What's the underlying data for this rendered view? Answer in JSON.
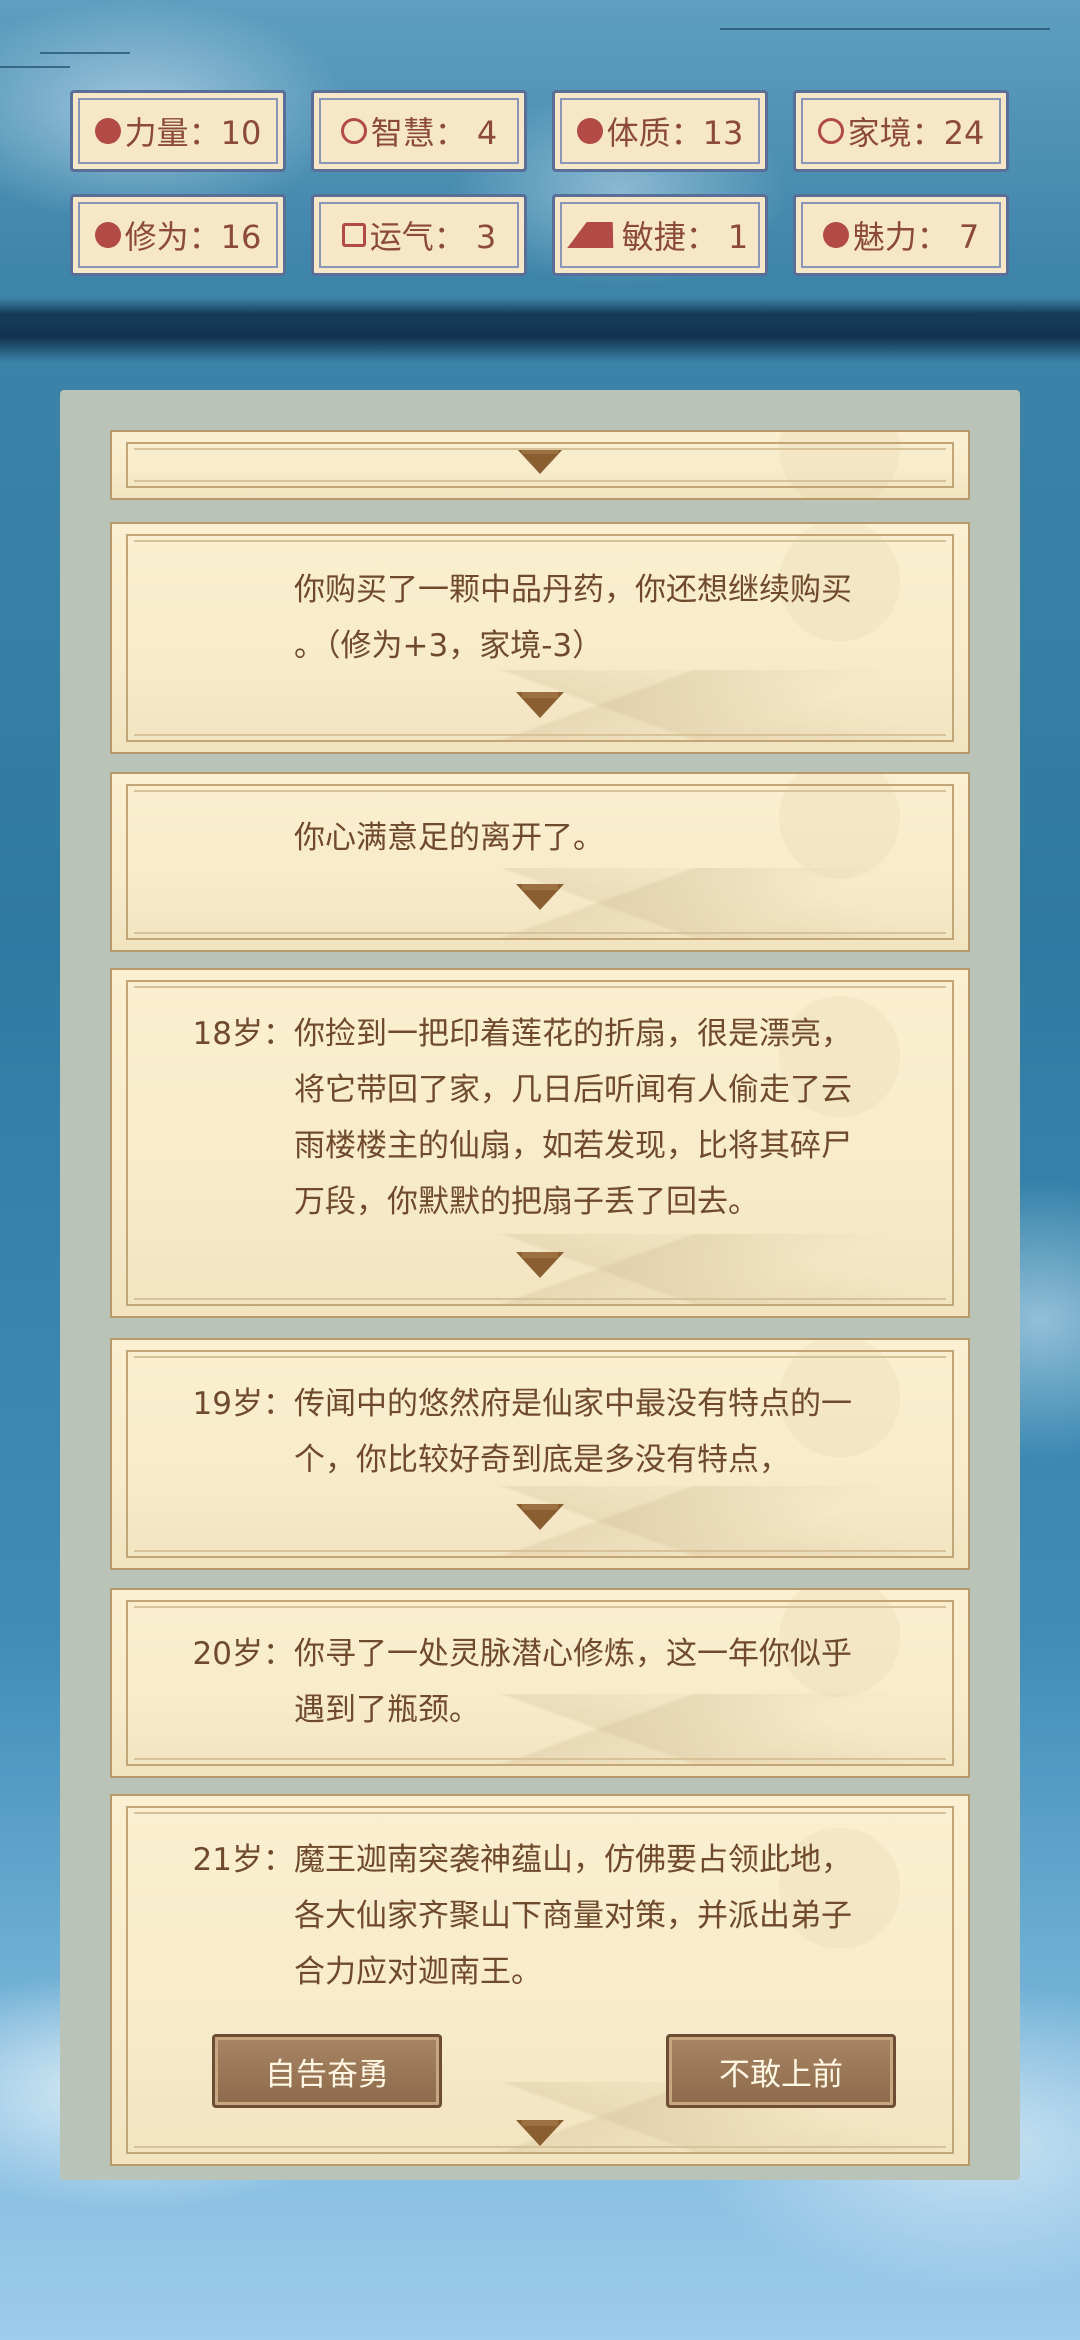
{
  "stats": [
    {
      "icon": "strength-icon",
      "text": "力量：10"
    },
    {
      "icon": "bulb-icon",
      "text": "智慧： 4"
    },
    {
      "icon": "constitution-icon",
      "text": "体质：13"
    },
    {
      "icon": "family-icon",
      "text": "家境：24"
    },
    {
      "icon": "cloud-icon",
      "text": "修为：16"
    },
    {
      "icon": "luck-icon",
      "text": "运气： 3"
    },
    {
      "icon": "lightning-icon",
      "text": "敏捷： 1"
    },
    {
      "icon": "heart-icon",
      "text": "魅力： 7"
    }
  ],
  "events": [
    {
      "age": "",
      "text": ""
    },
    {
      "age": "",
      "text": "你购买了一颗中品丹药，你还想继续购买\n。（修为+3，家境-3）"
    },
    {
      "age": "",
      "text": "你心满意足的离开了。"
    },
    {
      "age": "18岁：",
      "text": "你捡到一把印着莲花的折扇，很是漂亮，\n将它带回了家，几日后听闻有人偷走了云\n雨楼楼主的仙扇，如若发现，比将其碎尸\n万段，你默默的把扇子丢了回去。"
    },
    {
      "age": "19岁：",
      "text": "传闻中的悠然府是仙家中最没有特点的一\n个，你比较好奇到底是多没有特点，"
    },
    {
      "age": "20岁：",
      "text": "你寻了一处灵脉潜心修炼，这一年你似乎\n遇到了瓶颈。"
    },
    {
      "age": "21岁：",
      "text": "魔王迦南突袭神蕴山，仿佛要占领此地，\n各大仙家齐聚山下商量对策，并派出弟子\n合力应对迦南王。"
    }
  ],
  "choices": {
    "brave": "自告奋勇",
    "retreat": "不敢上前"
  },
  "colors": {
    "text": "#6f4a2d",
    "badge_text": "#8b4a3a",
    "icon": "#b24a45",
    "button": "#8c6a4b"
  }
}
